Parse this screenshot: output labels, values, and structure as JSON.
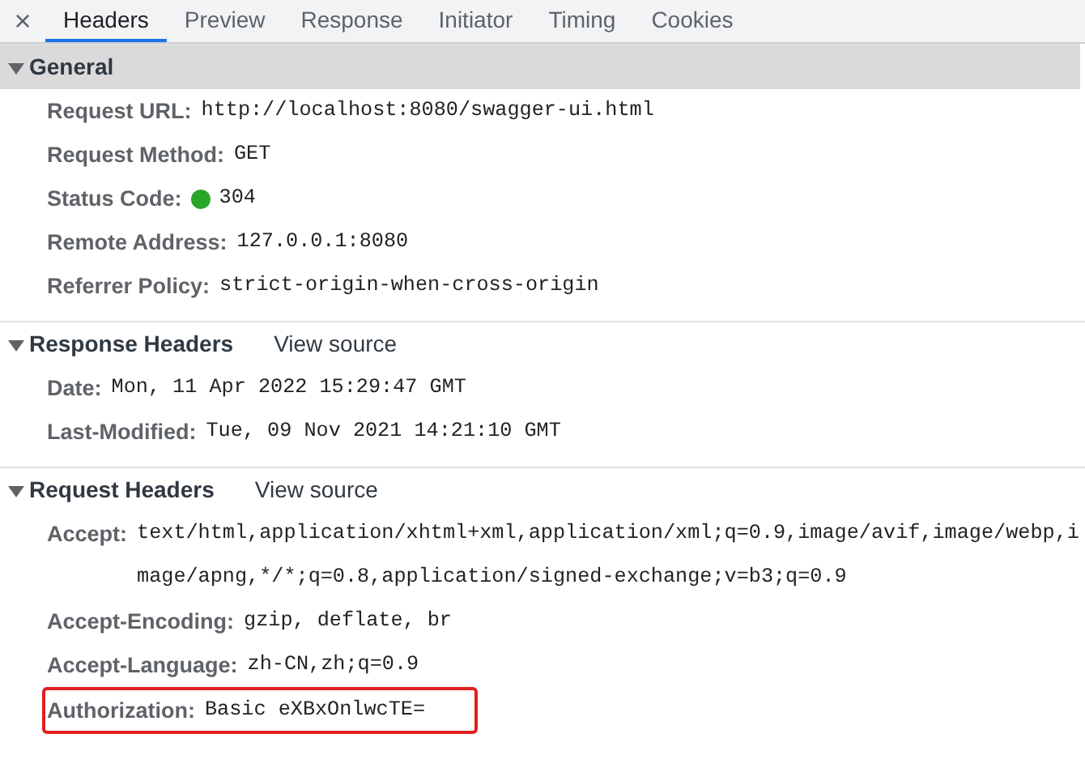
{
  "close": "×",
  "tabs": [
    {
      "label": "Headers",
      "selected": true
    },
    {
      "label": "Preview",
      "selected": false
    },
    {
      "label": "Response",
      "selected": false
    },
    {
      "label": "Initiator",
      "selected": false
    },
    {
      "label": "Timing",
      "selected": false
    },
    {
      "label": "Cookies",
      "selected": false
    }
  ],
  "sections": [
    {
      "title": "General",
      "expanded": true,
      "focused": true,
      "rows": [
        {
          "name": "Request URL:",
          "value": "http://localhost:8080/swagger-ui.html",
          "highlighted": false
        },
        {
          "name": "Request Method:",
          "value": "GET",
          "highlighted": false
        },
        {
          "name": "Status Code:",
          "value": "304",
          "color": "#2aa52a",
          "highlighted": false
        },
        {
          "name": "Remote Address:",
          "value": "127.0.0.1:8080",
          "highlighted": false
        },
        {
          "name": "Referrer Policy:",
          "value": "strict-origin-when-cross-origin",
          "highlighted": false
        }
      ]
    },
    {
      "title": "Response Headers",
      "view_source": "View source",
      "expanded": true,
      "focused": false,
      "rows": [
        {
          "name": "Date:",
          "value": "Mon, 11 Apr 2022 15:29:47 GMT",
          "highlighted": false
        },
        {
          "name": "Last-Modified:",
          "value": "Tue, 09 Nov 2021 14:21:10 GMT",
          "highlighted": false
        }
      ]
    },
    {
      "title": "Request Headers",
      "view_source": "View source",
      "expanded": true,
      "focused": false,
      "rows": [
        {
          "name": "Accept:",
          "value": "text/html,application/xhtml+xml,application/xml;q=0.9,image/avif,image/webp,image/apng,*/*;q=0.8,application/signed-exchange;v=b3;q=0.9",
          "highlighted": false
        },
        {
          "name": "Accept-Encoding:",
          "value": "gzip, deflate, br",
          "highlighted": false
        },
        {
          "name": "Accept-Language:",
          "value": "zh-CN,zh;q=0.9",
          "highlighted": false
        },
        {
          "name": "Authorization:",
          "value": "Basic eXBxOnlwcTE=",
          "highlighted": true
        }
      ]
    }
  ]
}
